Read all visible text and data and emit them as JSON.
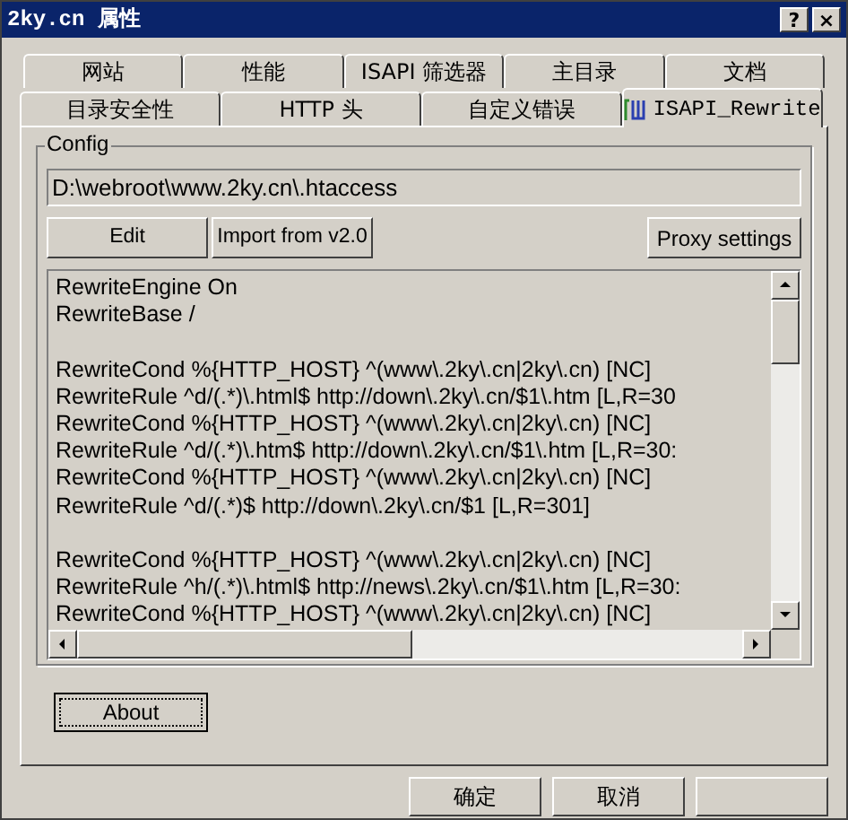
{
  "window": {
    "title": "2ky.cn 属性",
    "buttons": [
      "?",
      "×"
    ]
  },
  "tabs_row_1": [
    {
      "label": "网站",
      "selected": false
    },
    {
      "label": "性能",
      "selected": false
    },
    {
      "label": "ISAPI 筛选器",
      "selected": false
    },
    {
      "label": "主目录",
      "selected": false
    },
    {
      "label": "文档",
      "selected": false
    }
  ],
  "tabs_row_2": [
    {
      "label": "目录安全性",
      "selected": false
    },
    {
      "label": "HTTP 头",
      "selected": false
    },
    {
      "label": "自定义错误",
      "selected": false
    },
    {
      "label": "ISAPI_Rewrite",
      "selected": true
    }
  ],
  "config": {
    "title": "Config",
    "path": "D:\\webroot\\www.2ky.cn\\.htaccess",
    "buttons": [
      "Edit",
      "Import from v2.0"
    ],
    "proxy_button": "Proxy settings",
    "editor_blocks": [
      [
        "RewriteEngine On",
        "RewriteBase /"
      ],
      [
        "RewriteCond %{HTTP_HOST} ^(www\\.2ky\\.cn|2ky\\.cn) [NC]",
        "RewriteRule ^d/(.*)\\.html$ http://down\\.2ky\\.cn/$1\\.htm [L,R=30",
        "RewriteCond %{HTTP_HOST} ^(www\\.2ky\\.cn|2ky\\.cn) [NC]",
        "RewriteRule ^d/(.*)\\.htm$ http://down\\.2ky\\.cn/$1\\.htm [L,R=30:",
        "RewriteCond %{HTTP_HOST} ^(www\\.2ky\\.cn|2ky\\.cn) [NC]",
        "RewriteRule ^d/(.*)$ http://down\\.2ky\\.cn/$1 [L,R=301]"
      ],
      [
        "RewriteCond %{HTTP_HOST} ^(www\\.2ky\\.cn|2ky\\.cn) [NC]",
        "RewriteRule ^h/(.*)\\.html$ http://news\\.2ky\\.cn/$1\\.htm [L,R=30:",
        "RewriteCond %{HTTP_HOST} ^(www\\.2ky\\.cn|2ky\\.cn) [NC]"
      ]
    ]
  },
  "about_button": "About",
  "footer_buttons": [
    "确定",
    "取消"
  ]
}
